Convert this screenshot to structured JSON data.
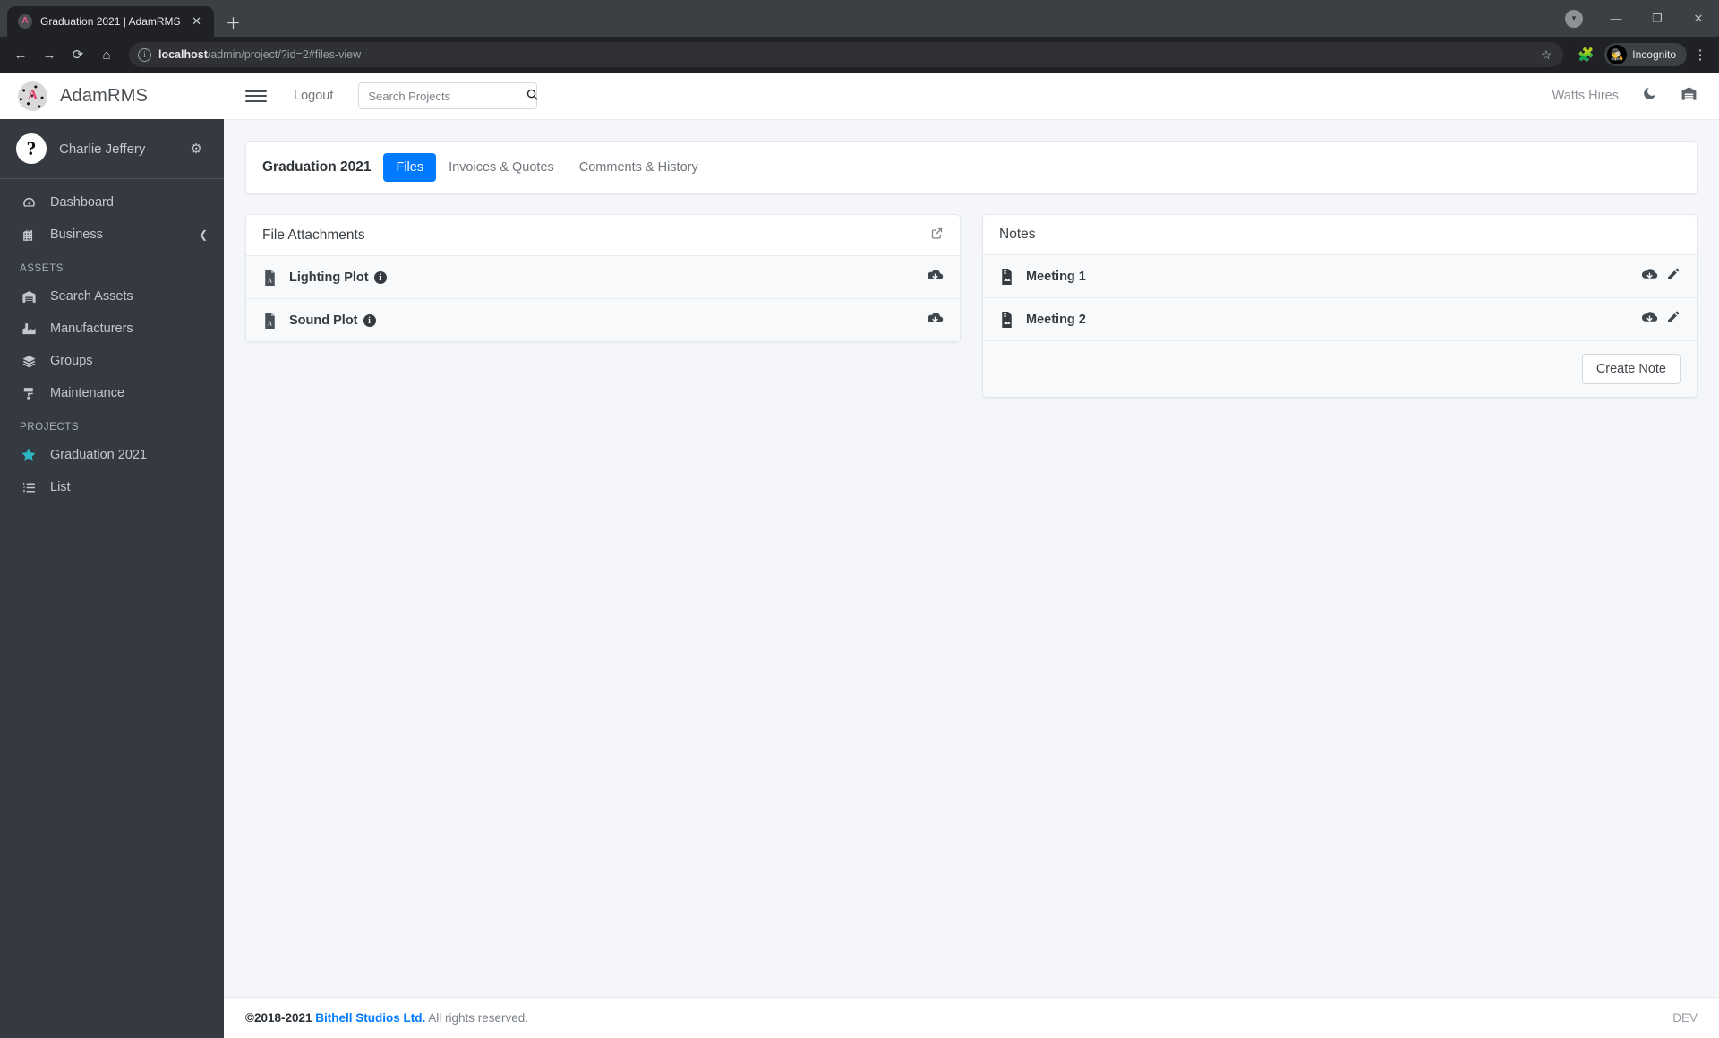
{
  "browser": {
    "tab": {
      "favicon_letter": "A",
      "title": "Graduation 2021 | AdamRMS",
      "close_icon": "✕"
    },
    "new_tab_icon": "＋",
    "window": {
      "minimize": "—",
      "maximize": "❐",
      "close": "✕",
      "profile_icon": "▾"
    },
    "nav": {
      "back": "←",
      "forward": "→",
      "reload": "⟳",
      "home": "⌂"
    },
    "omnibox": {
      "info_icon": "i",
      "url_host": "localhost",
      "url_path": "/admin/project/?id=2#files-view",
      "star_icon": "☆"
    },
    "extensions_icon": "🧩",
    "incognito": {
      "label": "Incognito",
      "avatar_icon": "🕵"
    },
    "menu_icon": "⋮"
  },
  "sidebar": {
    "brand": {
      "logo_letter": "A",
      "name": "AdamRMS"
    },
    "user": {
      "avatar_glyph": "?",
      "name": "Charlie Jeffery",
      "settings_icon": "⚙"
    },
    "items": [
      {
        "label": "Dashboard",
        "icon": "◷",
        "type": "link"
      },
      {
        "label": "Business",
        "icon": "🏢",
        "type": "expandable",
        "caret": "❮"
      },
      {
        "label": "ASSETS",
        "type": "header"
      },
      {
        "label": "Search Assets",
        "icon": "🏚",
        "type": "link"
      },
      {
        "label": "Manufacturers",
        "icon": "🏭",
        "type": "link"
      },
      {
        "label": "Groups",
        "icon": "≋",
        "type": "link"
      },
      {
        "label": "Maintenance",
        "icon": "🖌",
        "type": "link"
      },
      {
        "label": "PROJECTS",
        "type": "header"
      },
      {
        "label": "Graduation 2021",
        "icon": "★",
        "type": "link",
        "accent": "#2bb7c4"
      },
      {
        "label": "List",
        "icon": "☰",
        "type": "link"
      }
    ]
  },
  "appbar": {
    "menu_toggle_icon": "hamburger",
    "logout_label": "Logout",
    "search": {
      "value": "",
      "placeholder": "Search Projects",
      "icon": "⚲"
    },
    "company": "Watts Hires",
    "dark_mode_icon": "☾",
    "warehouse_icon": "🏚"
  },
  "main": {
    "project_title": "Graduation 2021",
    "tabs": [
      {
        "label": "Files",
        "active": true
      },
      {
        "label": "Invoices & Quotes",
        "active": false
      },
      {
        "label": "Comments & History",
        "active": false
      }
    ],
    "files_card": {
      "title": "File Attachments",
      "expand_icon": "↗",
      "rows": [
        {
          "label": "Lighting Plot",
          "file_icon": "pdf",
          "info_icon": "i",
          "download_icon": "⬇"
        },
        {
          "label": "Sound Plot",
          "file_icon": "pdf",
          "info_icon": "i",
          "download_icon": "⬇"
        }
      ]
    },
    "notes_card": {
      "title": "Notes",
      "rows": [
        {
          "label": "Meeting 1",
          "file_icon": "doc",
          "download_icon": "⬇",
          "edit_icon": "✎"
        },
        {
          "label": "Meeting 2",
          "file_icon": "doc",
          "download_icon": "⬇",
          "edit_icon": "✎"
        }
      ],
      "create_button": "Create Note"
    }
  },
  "footer": {
    "copyright": "©2018-2021 ",
    "company_link": "Bithell Studios Ltd.",
    "rights": " All rights reserved.",
    "env": "DEV"
  },
  "colors": {
    "accent": "#007bff",
    "sidebar_bg": "#343a40",
    "content_bg": "#f4f6f9",
    "star_accent": "#2bb7c4",
    "link": "#007bff"
  }
}
